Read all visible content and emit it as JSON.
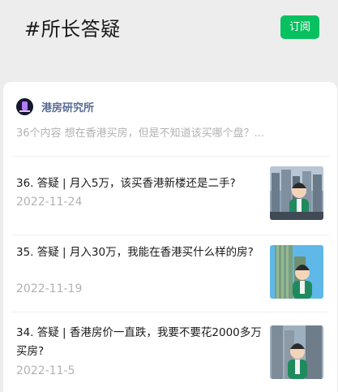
{
  "header": {
    "title": "#所长答疑",
    "subscribe_label": "订阅"
  },
  "album": {
    "name": "港房研究所",
    "description": "36个内容  想在香港买房，但是不知道该买哪个盘？..."
  },
  "articles": [
    {
      "title": "36. 答疑 | 月入5万，该买香港新楼还是二手?",
      "date": "2022-11-24"
    },
    {
      "title": "35. 答疑 | 月入30万，我能在香港买什么样的房?",
      "date": "2022-11-19"
    },
    {
      "title": "34. 答疑 | 香港房价一直跌，我要不要花2000多万买房?",
      "date": "2022-11-5"
    }
  ],
  "colors": {
    "accent": "#07c160",
    "link": "#576b95",
    "muted": "#b2b2b2",
    "background": "#ededed"
  }
}
